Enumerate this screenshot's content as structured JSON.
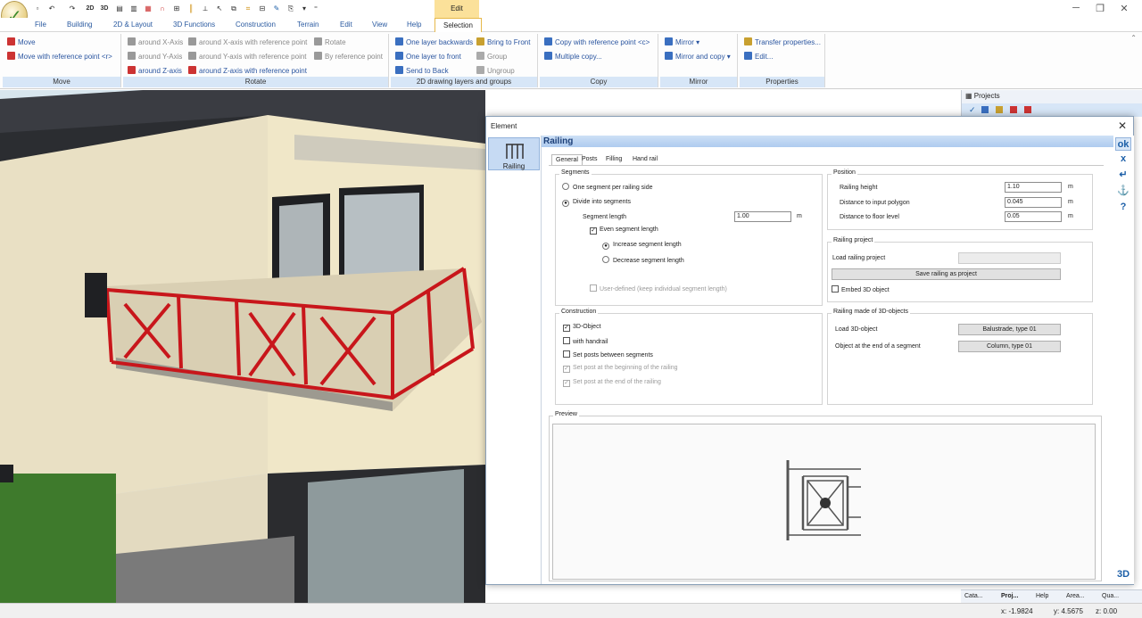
{
  "window": {
    "context_tab": "Edit"
  },
  "menubar": [
    "File",
    "Building",
    "2D & Layout",
    "3D Functions",
    "Construction",
    "Terrain",
    "Edit",
    "View",
    "Help",
    "Selection"
  ],
  "ribbon": {
    "move": {
      "label": "Move",
      "items": [
        "Move",
        "Move with reference point <r>"
      ]
    },
    "rotate": {
      "label": "Rotate",
      "items": [
        "around X-Axis",
        "around Y-Axis",
        "around Z-axis",
        "around X-axis with reference point",
        "around Y-axis with reference point",
        "around Z-axis with reference point",
        "Rotate",
        "By reference point"
      ]
    },
    "layers": {
      "label": "2D drawing layers and groups",
      "items": [
        "One layer backwards",
        "One layer to front",
        "Send to Back",
        "Bring to Front",
        "Group",
        "Ungroup"
      ]
    },
    "copy": {
      "label": "Copy",
      "items": [
        "Copy with reference point <c>",
        "Multiple copy..."
      ]
    },
    "mirror": {
      "label": "Mirror",
      "items": [
        "Mirror",
        "Mirror and copy"
      ]
    },
    "properties": {
      "label": "Properties",
      "items": [
        "Transfer properties...",
        "Edit..."
      ]
    }
  },
  "projects_panel": {
    "title": "Projects"
  },
  "bottom_tabs": [
    "Cata...",
    "Proj...",
    "Help",
    "Area...",
    "Qua..."
  ],
  "status": {
    "x": "x: -1.9824",
    "y": "y: 4.5675",
    "z": "z: 0.00"
  },
  "dialog": {
    "title": "Element",
    "side_item": "Railing",
    "heading": "Railing",
    "tabs": [
      "General",
      "Posts",
      "Filling",
      "Hand rail"
    ],
    "segments": {
      "legend": "Segments",
      "opt1": "One segment per railing side",
      "opt2": "Divide into segments",
      "seg_len_label": "Segment length",
      "seg_len_value": "1.00",
      "unit": "m",
      "even": "Even segment length",
      "increase": "Increase segment length",
      "decrease": "Decrease segment length",
      "user_defined": "User-defined (keep individual segment length)"
    },
    "position": {
      "legend": "Position",
      "height_label": "Railing height",
      "height_value": "1.10",
      "dist_poly_label": "Distance to input polygon",
      "dist_poly_value": "0.045",
      "dist_floor_label": "Distance to floor level",
      "dist_floor_value": "0.05",
      "unit": "m"
    },
    "railing_project": {
      "legend": "Railing project",
      "load_label": "Load railing project",
      "save_btn": "Save railing as project",
      "embed": "Embed 3D object"
    },
    "construction": {
      "legend": "Construction",
      "obj3d": "3D-Object",
      "handrail": "with handrail",
      "posts_between": "Set posts between segments",
      "post_begin": "Set post at the beginning of the railing",
      "post_end": "Set post at the end of the railing"
    },
    "railing3d": {
      "legend": "Railing made of 3D-objects",
      "load_label": "Load 3D-object",
      "load_btn": "Balustrade, type 01",
      "end_label": "Object at the end of a  segment",
      "end_btn": "Column, type 01"
    },
    "preview": {
      "legend": "Preview"
    },
    "tools": [
      "ok",
      "x",
      "↵",
      "⚓",
      "?",
      "3D"
    ]
  }
}
